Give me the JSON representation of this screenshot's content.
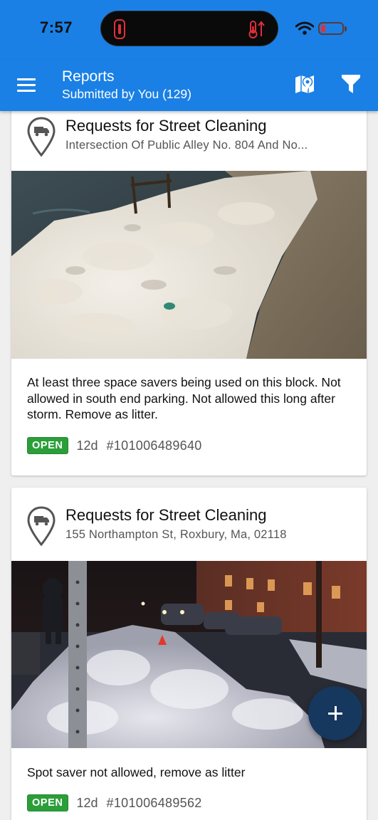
{
  "status_bar": {
    "time": "7:57",
    "battery_level_fraction": 0.2
  },
  "app_bar": {
    "title": "Reports",
    "subtitle": "Submitted by You (129)",
    "icons": [
      "menu-icon",
      "map-icon",
      "filter-icon"
    ]
  },
  "reports": [
    {
      "category": "Requests for Street Cleaning",
      "address": "Intersection Of Public Alley No. 804 And No...",
      "description": "At least three space savers being used on this block. Not allowed in south end parking. Not allowed this long after storm. Remove as litter.",
      "status": "OPEN",
      "age": "12d",
      "id": "#101006489640",
      "icon": "truck-pin-icon"
    },
    {
      "category": "Requests for Street Cleaning",
      "address": "155 Northampton St, Roxbury, Ma, 02118",
      "description": "Spot saver not allowed, remove as litter",
      "status": "OPEN",
      "age": "12d",
      "id": "#101006489562",
      "icon": "truck-pin-icon"
    }
  ],
  "fab": {
    "icon": "plus-icon"
  },
  "colors": {
    "primary": "#1a80e5",
    "fab": "#16375e",
    "status_open": "#2b9e3a"
  }
}
